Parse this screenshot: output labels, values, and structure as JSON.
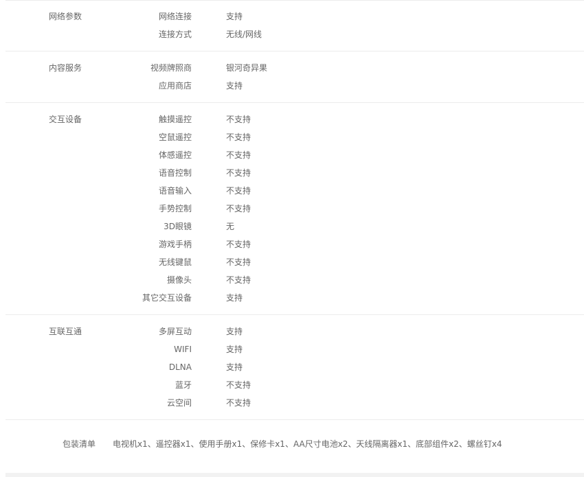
{
  "sections": [
    {
      "title": "网络参数",
      "rows": [
        {
          "key": "网络连接",
          "value": "支持"
        },
        {
          "key": "连接方式",
          "value": "无线/网线"
        }
      ]
    },
    {
      "title": "内容服务",
      "rows": [
        {
          "key": "视频牌照商",
          "value": "银河奇异果"
        },
        {
          "key": "应用商店",
          "value": "支持"
        }
      ]
    },
    {
      "title": "交互设备",
      "rows": [
        {
          "key": "触摸遥控",
          "value": "不支持"
        },
        {
          "key": "空鼠遥控",
          "value": "不支持"
        },
        {
          "key": "体感遥控",
          "value": "不支持"
        },
        {
          "key": "语音控制",
          "value": "不支持"
        },
        {
          "key": "语音输入",
          "value": "不支持"
        },
        {
          "key": "手势控制",
          "value": "不支持"
        },
        {
          "key": "3D眼镜",
          "value": "无"
        },
        {
          "key": "游戏手柄",
          "value": "不支持"
        },
        {
          "key": "无线键鼠",
          "value": "不支持"
        },
        {
          "key": "摄像头",
          "value": "不支持"
        },
        {
          "key": "其它交互设备",
          "value": "支持"
        }
      ]
    },
    {
      "title": "互联互通",
      "rows": [
        {
          "key": "多屏互动",
          "value": "支持"
        },
        {
          "key": "WIFI",
          "value": "支持"
        },
        {
          "key": "DLNA",
          "value": "支持"
        },
        {
          "key": "蓝牙",
          "value": "不支持"
        },
        {
          "key": "云空间",
          "value": "不支持"
        }
      ]
    }
  ],
  "package": {
    "title": "包装清单",
    "value": "电视机x1、遥控器x1、使用手册x1、保修卡x1、AA尺寸电池x2、天线隔离器x1、底部组件x2、螺丝钉x4"
  }
}
